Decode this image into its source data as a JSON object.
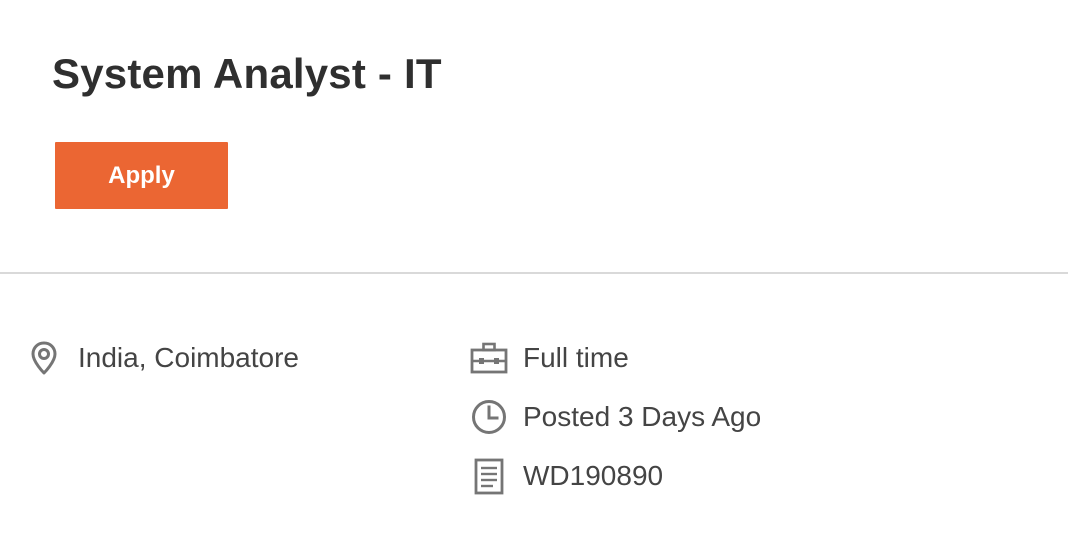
{
  "job": {
    "title": "System Analyst - IT",
    "apply_label": "Apply",
    "accent_color": "#eb6633"
  },
  "details": {
    "location": {
      "icon": "location-pin-icon",
      "text": "India, Coimbatore"
    },
    "time_type": {
      "icon": "briefcase-icon",
      "text": "Full time"
    },
    "posted": {
      "icon": "clock-icon",
      "text": "Posted 3 Days Ago"
    },
    "requisition": {
      "icon": "document-icon",
      "text": "WD190890"
    }
  }
}
